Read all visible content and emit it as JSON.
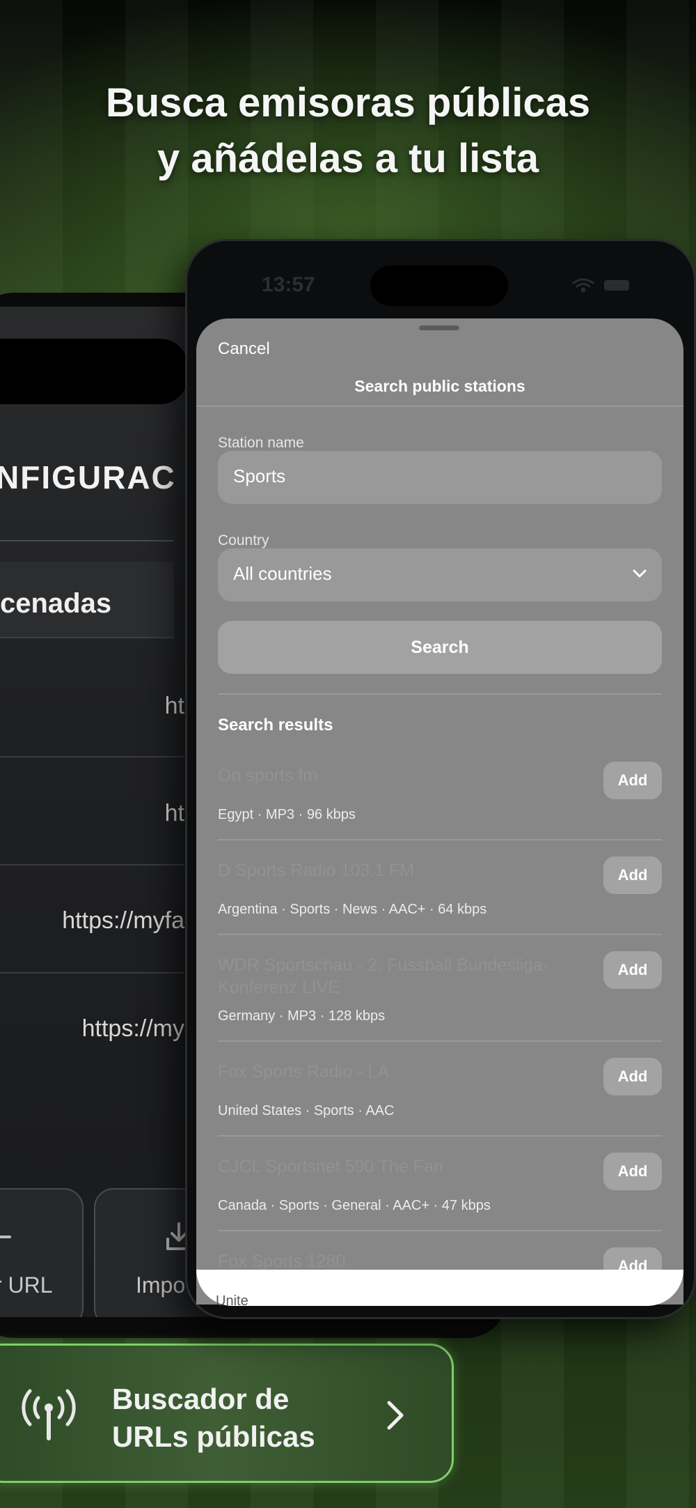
{
  "headline": {
    "line1": "Busca emisoras públicas",
    "line2": "y añádelas a tu lista"
  },
  "back_app": {
    "title_fragment": "NFIGURAC",
    "section_fragment": "cenadas",
    "url_rows": [
      "ht",
      "ht",
      "https://myfa",
      "https://my"
    ],
    "tiles": [
      {
        "label": "r URL",
        "icon": "minus-icon"
      },
      {
        "label": "Impo",
        "icon": "download-icon"
      }
    ],
    "finder_banner": {
      "line1": "Buscador de",
      "line2": "URLs públicas",
      "icon": "antenna-icon"
    }
  },
  "status_bar": {
    "time": "13:57"
  },
  "sheet": {
    "cancel_label": "Cancel",
    "title": "Search public stations",
    "station_name_label": "Station name",
    "station_name_value": "Sports",
    "country_label": "Country",
    "country_value": "All countries",
    "search_label": "Search",
    "results_title": "Search results",
    "add_label": "Add",
    "results": [
      {
        "name": "On sports fm",
        "meta": "Egypt · MP3 · 96 kbps"
      },
      {
        "name": "D Sports Radio 103.1 FM",
        "meta": "Argentina · Sports · News · AAC+ · 64 kbps"
      },
      {
        "name": "WDR Sportschau - 2. Fussball Bundesliga-Konferenz LIVE",
        "meta": "Germany · MP3 · 128 kbps"
      },
      {
        "name": "Fox Sports Radio - LA",
        "meta": "United States · Sports · AAC"
      },
      {
        "name": "CJCL Sportsnet 590 The Fan",
        "meta": "Canada · Sports · General · AAC+ · 47 kbps"
      },
      {
        "name": "Fox Sports 1280",
        "meta": "Unite"
      }
    ]
  },
  "colors": {
    "accent_green": "#7fd06a",
    "sheet_gray": "#878787"
  }
}
